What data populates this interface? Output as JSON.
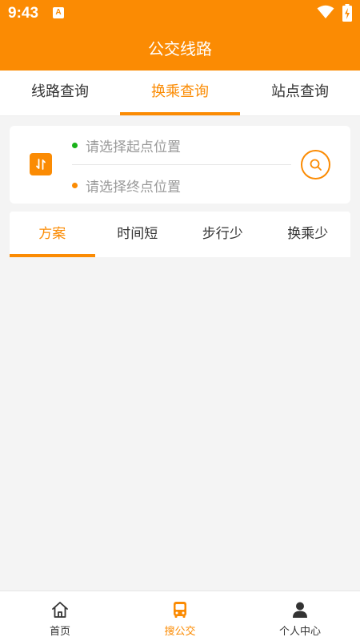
{
  "status_bar": {
    "time": "9:43",
    "indicator": "A"
  },
  "header": {
    "title": "公交线路"
  },
  "top_tabs": [
    {
      "label": "线路查询",
      "active": false
    },
    {
      "label": "换乘查询",
      "active": true
    },
    {
      "label": "站点查询",
      "active": false
    }
  ],
  "route": {
    "start_placeholder": "请选择起点位置",
    "end_placeholder": "请选择终点位置"
  },
  "plan_tabs": [
    {
      "label": "方案",
      "active": true
    },
    {
      "label": "时间短",
      "active": false
    },
    {
      "label": "步行少",
      "active": false
    },
    {
      "label": "换乘少",
      "active": false
    }
  ],
  "bottom_nav": [
    {
      "label": "首页",
      "icon": "home-icon",
      "active": false
    },
    {
      "label": "搜公交",
      "icon": "bus-icon",
      "active": true
    },
    {
      "label": "个人中心",
      "icon": "person-icon",
      "active": false
    }
  ],
  "colors": {
    "accent": "#fb8b03",
    "start_dot": "#19b219",
    "background": "#f4f4f4"
  }
}
